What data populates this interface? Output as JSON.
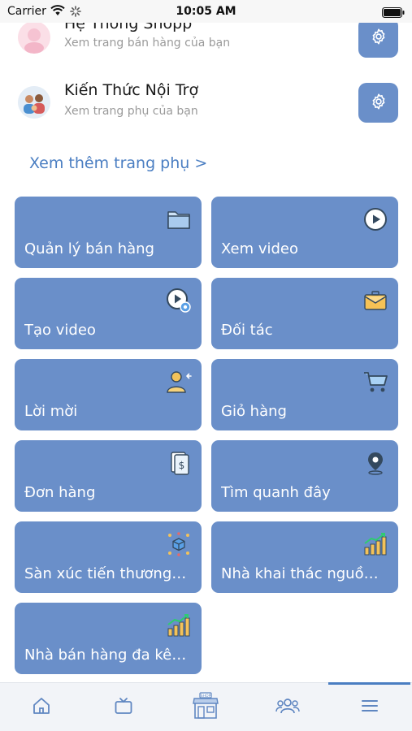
{
  "status_bar": {
    "carrier": "Carrier",
    "time": "10:05 AM"
  },
  "pages": [
    {
      "name": "Hệ Thống Shopp",
      "subtitle": "Xem trang bán hàng của bạn",
      "avatar_icon": "pink-avatar-icon"
    },
    {
      "name": "Kiến Thức Nội Trợ",
      "subtitle": "Xem trang phụ của bạn",
      "avatar_icon": "people-avatar-icon"
    }
  ],
  "more_pages_link": "Xem thêm trang phụ >",
  "tiles": [
    {
      "label": "Quản lý bán hàng",
      "icon": "folder-icon"
    },
    {
      "label": "Xem video",
      "icon": "play-icon"
    },
    {
      "label": "Tạo video",
      "icon": "create-video-icon"
    },
    {
      "label": "Đối tác",
      "icon": "briefcase-icon"
    },
    {
      "label": "Lời mời",
      "icon": "add-user-icon"
    },
    {
      "label": "Giỏ hàng",
      "icon": "cart-icon"
    },
    {
      "label": "Đơn hàng",
      "icon": "invoice-icon"
    },
    {
      "label": "Tìm quanh đây",
      "icon": "location-icon"
    },
    {
      "label": "Sàn xúc tiến thương mại",
      "icon": "box-network-icon"
    },
    {
      "label": "Nhà khai thác nguồn hàng",
      "icon": "growth-chart-icon"
    },
    {
      "label": "Nhà bán hàng đa kênh",
      "icon": "growth-chart-icon"
    }
  ],
  "tab_bar": {
    "items": [
      "home-icon",
      "tv-icon",
      "shop-icon",
      "friends-icon",
      "menu-icon"
    ],
    "active_index": 4,
    "shop_badge": "SHOP"
  },
  "colors": {
    "tile": "#6a8fc9",
    "link": "#4a7ec2",
    "tab_icon": "#5f86c1"
  }
}
